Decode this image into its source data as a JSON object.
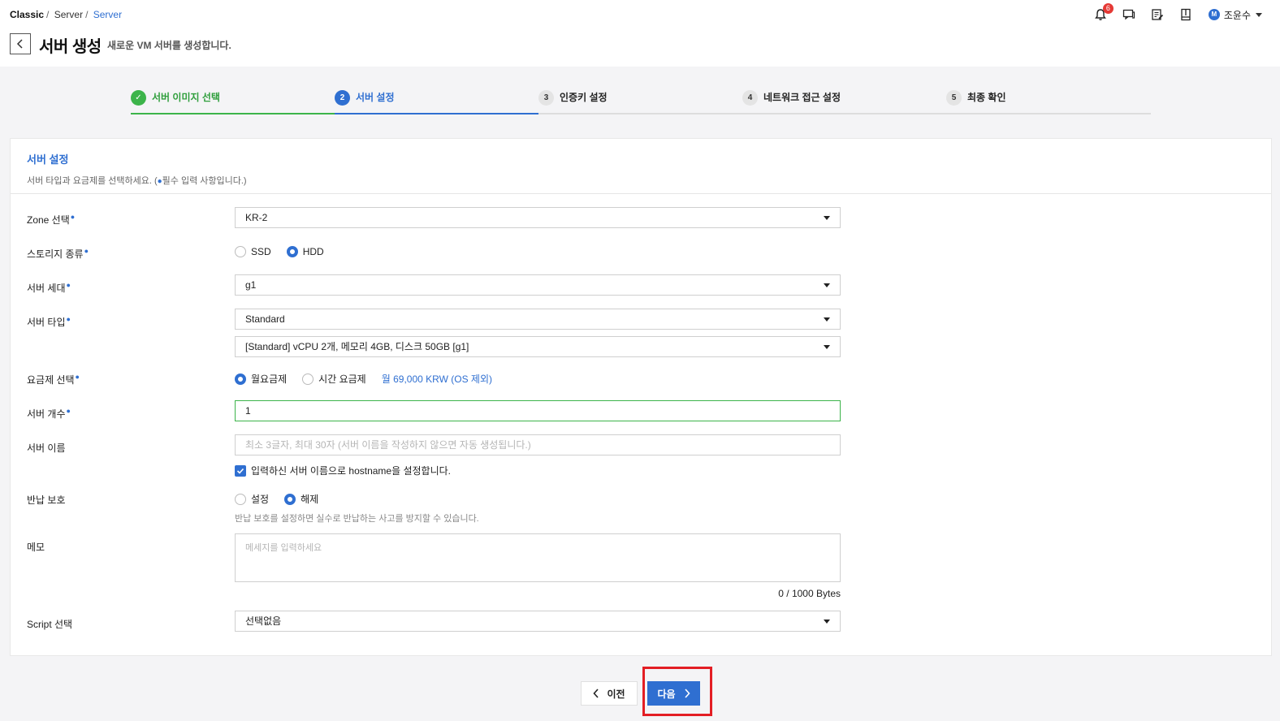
{
  "breadcrumb": [
    "Classic",
    "Server",
    "Server"
  ],
  "header": {
    "title": "서버 생성",
    "subtitle": "새로운 VM 서버를 생성합니다.",
    "notification_count": "6",
    "user_initial": "M",
    "user_name": "조윤수"
  },
  "steps": [
    {
      "num": "✓",
      "label": "서버 이미지 선택",
      "state": "done"
    },
    {
      "num": "2",
      "label": "서버 설정",
      "state": "active"
    },
    {
      "num": "3",
      "label": "인증키 설정",
      "state": "pending"
    },
    {
      "num": "4",
      "label": "네트워크 접근 설정",
      "state": "pending"
    },
    {
      "num": "5",
      "label": "최종 확인",
      "state": "pending"
    }
  ],
  "section": {
    "title": "서버 설정",
    "desc_before": "서버 타입과 요금제를 선택하세요. (",
    "desc_dot": "●",
    "desc_after": "필수 입력 사항입니다.)"
  },
  "form": {
    "required_mark": "●",
    "zone": {
      "label": "Zone 선택",
      "value": "KR-2"
    },
    "storage": {
      "label": "스토리지 종류",
      "options": [
        "SSD",
        "HDD"
      ],
      "selected": "HDD"
    },
    "generation": {
      "label": "서버 세대",
      "value": "g1"
    },
    "server_type": {
      "label": "서버 타입",
      "value": "Standard",
      "spec": "[Standard] vCPU 2개, 메모리 4GB, 디스크 50GB [g1]"
    },
    "plan": {
      "label": "요금제 선택",
      "options": [
        "월요금제",
        "시간 요금제"
      ],
      "selected": "월요금제",
      "price": "월 69,000 KRW (OS 제외)"
    },
    "count": {
      "label": "서버 개수",
      "value": "1"
    },
    "name": {
      "label": "서버 이름",
      "placeholder": "최소 3글자, 최대 30자 (서버 이름을 작성하지 않으면 자동 생성됩니다.)",
      "hostname_checkbox": "입력하신 서버 이름으로 hostname을 설정합니다."
    },
    "protection": {
      "label": "반납 보호",
      "options": [
        "설정",
        "해제"
      ],
      "selected": "해제",
      "hint": "반납 보호를 설정하면 실수로 반납하는 사고를 방지할 수 있습니다."
    },
    "memo": {
      "label": "메모",
      "placeholder": "메세지를 입력하세요",
      "counter": "0 / 1000 Bytes"
    },
    "script": {
      "label": "Script 선택",
      "value": "선택없음"
    }
  },
  "buttons": {
    "prev": "이전",
    "next": "다음"
  },
  "colors": {
    "accent": "#2f6fd1",
    "success": "#3cb44a",
    "highlight": "#e31e24"
  }
}
